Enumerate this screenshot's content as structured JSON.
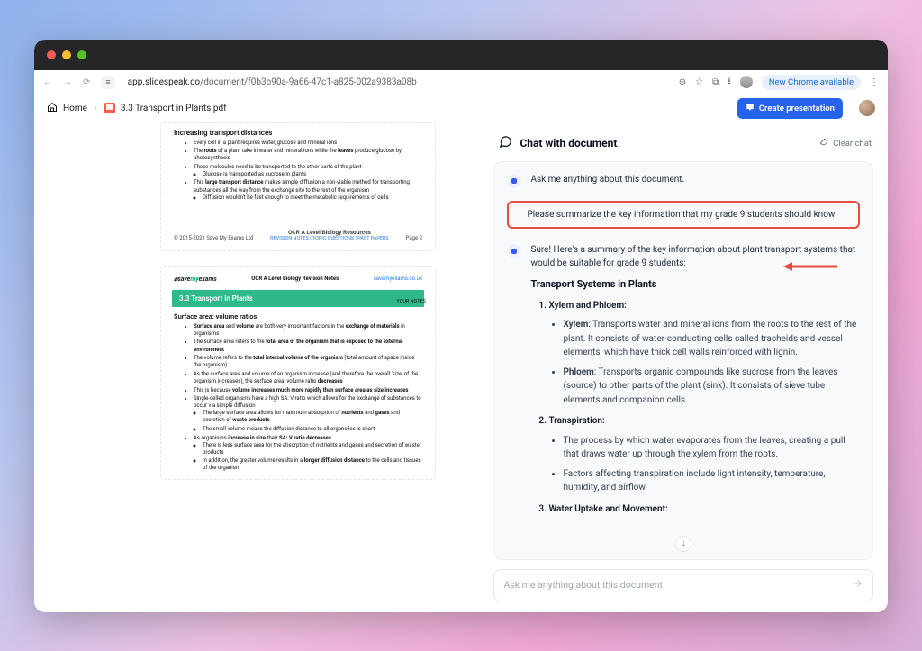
{
  "browser": {
    "url_host": "app.slidespeak.co",
    "url_path": "/document/f0b3b90a-9a66-47c1-a825-002a9383a08b",
    "site_label": "app.slidespeak.co",
    "new_chrome_label": "New Chrome available"
  },
  "appbar": {
    "home": "Home",
    "doc_title": "3.3 Transport in Plants.pdf",
    "create_label": "Create presentation"
  },
  "doc": {
    "page1": {
      "heading": "Increasing transport distances",
      "bullets": [
        "Every cell in a plant requires water, glucose and mineral ions",
        "The roots of a plant take in water and mineral ions while the leaves produce glucose by photosynthesis",
        "These molecules need to be transported to the other parts of the plant",
        "Glucose is transported as sucrose in plants",
        "This large transport distance makes simple diffusion a non-viable method for transporting substances all the way from the exchange site to the rest of the organism",
        "Diffusion wouldn't be fast enough to meet the metabolic requirements of cells"
      ],
      "footer_left": "© 2015-2021 Save My Exams Ltd",
      "footer_title": "OCR A Level Biology Resources",
      "footer_links": "REVISION NOTES  |  TOPIC QUESTIONS  |  PAST PAPERS",
      "page_no": "Page 2"
    },
    "page2": {
      "brand_pre": "save",
      "brand_my": "my",
      "brand_post": "exams",
      "top_center": "OCR A Level Biology Revision Notes",
      "top_right": "savemyexams.co.uk",
      "band_title": "3.3 Transport in Plants",
      "your_notes": "YOUR NOTES",
      "your_notes_arrow": "↓",
      "section_heading": "Surface area: volume ratios",
      "bullets": [
        "Surface area and volume are both very important factors in the exchange of materials in organisms",
        "The surface area refers to the total area of the organism that is exposed to the external environment",
        "The volume refers to the total internal volume of the organism (total amount of space inside the organism)",
        "As the surface area and volume of an organism increase (and therefore the overall 'size' of the organism increases), the surface area: volume ratio decreases",
        "This is because volume increases much more rapidly than surface area as size increases",
        "Single-celled organisms have a high SA: V ratio which allows for the exchange of substances to occur via simple diffusion",
        "The large surface area allows for maximum absorption of nutrients and gases and secretion of waste products",
        "The small volume means the diffusion distance to all organelles is short",
        "As organisms increase in size their SA: V ratio decreases",
        "There is less surface area for the absorption of nutrients and gases and secretion of waste products",
        "In addition, the greater volume results in a longer diffusion distance to the cells and tissues of the organism"
      ]
    }
  },
  "chat": {
    "title": "Chat with document",
    "clear": "Clear chat",
    "bot_intro": "Ask me anything about this document.",
    "user_query": "Please summarize the key information that my grade 9 students should know",
    "bot_reply_lead": "Sure! Here's a summary of the key information about plant transport systems that would be suitable for grade 9 students:",
    "reply_heading": "Transport Systems in Plants",
    "item1_label": "Xylem and Phloem:",
    "item1_a": "Xylem: Transports water and mineral ions from the roots to the rest of the plant. It consists of water-conducting cells called tracheids and vessel elements, which have thick cell walls reinforced with lignin.",
    "item1_b": "Phloem: Transports organic compounds like sucrose from the leaves (source) to other parts of the plant (sink). It consists of sieve tube elements and companion cells.",
    "item2_label": "Transpiration:",
    "item2_a": "The process by which water evaporates from the leaves, creating a pull that draws water up through the xylem from the roots.",
    "item2_b": "Factors affecting transpiration include light intensity, temperature, humidity, and airflow.",
    "item3_label": "Water Uptake and Movement:",
    "input_placeholder": "Ask me anything about this document"
  }
}
